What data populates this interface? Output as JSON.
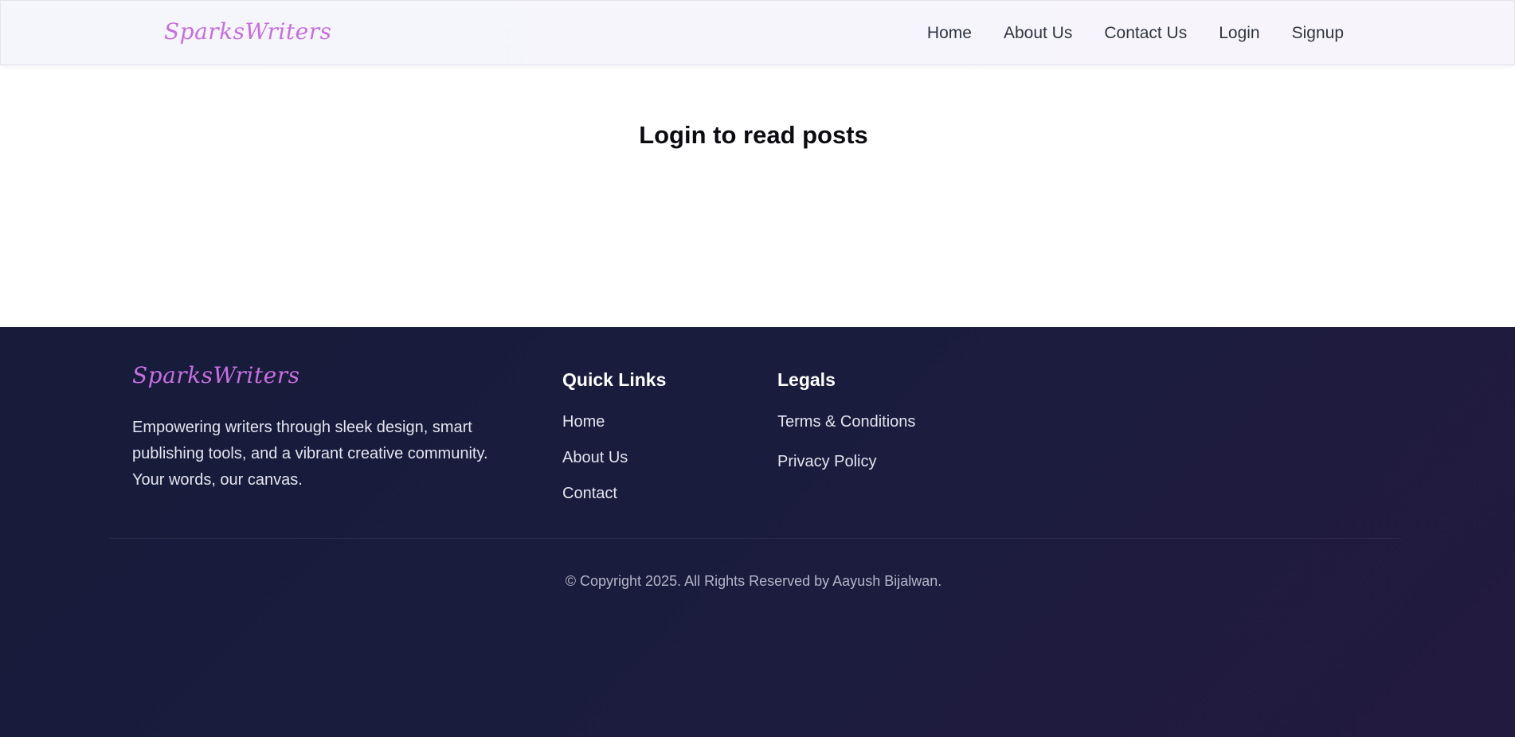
{
  "brand": {
    "logo_text": "SparksWriters",
    "accent": "#c86ee0"
  },
  "nav": {
    "items": [
      {
        "label": "Home"
      },
      {
        "label": "About Us"
      },
      {
        "label": "Contact Us"
      },
      {
        "label": "Login"
      },
      {
        "label": "Signup"
      }
    ]
  },
  "main": {
    "title": "Login to read posts"
  },
  "footer": {
    "description": "Empowering writers through sleek design, smart publishing tools, and a vibrant creative community. Your words, our canvas.",
    "quick_links": {
      "title": "Quick Links",
      "items": [
        {
          "label": "Home"
        },
        {
          "label": "About Us"
        },
        {
          "label": "Contact"
        }
      ]
    },
    "legals": {
      "title": "Legals",
      "items": [
        {
          "label": "Terms & Conditions"
        },
        {
          "label": "Privacy Policy"
        }
      ]
    },
    "copyright": "© Copyright 2025. All Rights Reserved by Aayush Bijalwan."
  }
}
